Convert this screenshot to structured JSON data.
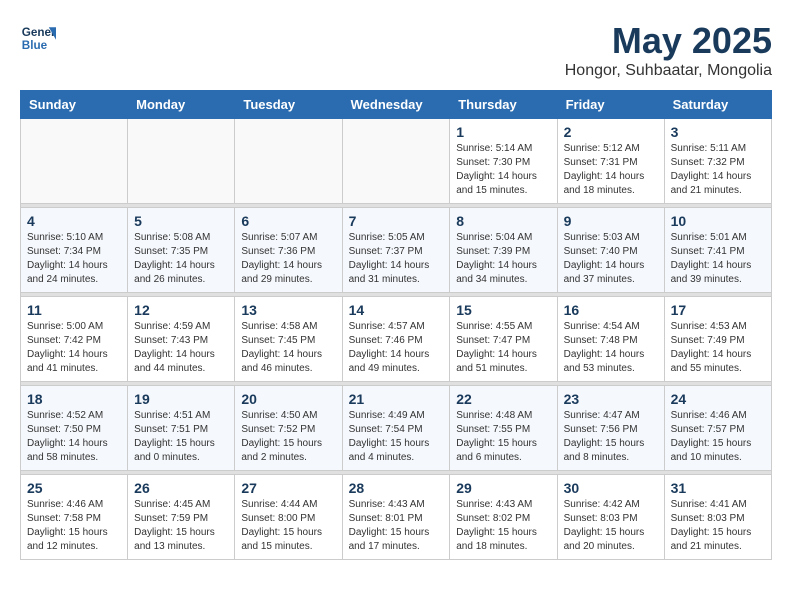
{
  "header": {
    "logo_line1": "General",
    "logo_line2": "Blue",
    "month": "May 2025",
    "location": "Hongor, Suhbaatar, Mongolia"
  },
  "days_of_week": [
    "Sunday",
    "Monday",
    "Tuesday",
    "Wednesday",
    "Thursday",
    "Friday",
    "Saturday"
  ],
  "weeks": [
    [
      {
        "day": "",
        "info": ""
      },
      {
        "day": "",
        "info": ""
      },
      {
        "day": "",
        "info": ""
      },
      {
        "day": "",
        "info": ""
      },
      {
        "day": "1",
        "info": "Sunrise: 5:14 AM\nSunset: 7:30 PM\nDaylight: 14 hours\nand 15 minutes."
      },
      {
        "day": "2",
        "info": "Sunrise: 5:12 AM\nSunset: 7:31 PM\nDaylight: 14 hours\nand 18 minutes."
      },
      {
        "day": "3",
        "info": "Sunrise: 5:11 AM\nSunset: 7:32 PM\nDaylight: 14 hours\nand 21 minutes."
      }
    ],
    [
      {
        "day": "4",
        "info": "Sunrise: 5:10 AM\nSunset: 7:34 PM\nDaylight: 14 hours\nand 24 minutes."
      },
      {
        "day": "5",
        "info": "Sunrise: 5:08 AM\nSunset: 7:35 PM\nDaylight: 14 hours\nand 26 minutes."
      },
      {
        "day": "6",
        "info": "Sunrise: 5:07 AM\nSunset: 7:36 PM\nDaylight: 14 hours\nand 29 minutes."
      },
      {
        "day": "7",
        "info": "Sunrise: 5:05 AM\nSunset: 7:37 PM\nDaylight: 14 hours\nand 31 minutes."
      },
      {
        "day": "8",
        "info": "Sunrise: 5:04 AM\nSunset: 7:39 PM\nDaylight: 14 hours\nand 34 minutes."
      },
      {
        "day": "9",
        "info": "Sunrise: 5:03 AM\nSunset: 7:40 PM\nDaylight: 14 hours\nand 37 minutes."
      },
      {
        "day": "10",
        "info": "Sunrise: 5:01 AM\nSunset: 7:41 PM\nDaylight: 14 hours\nand 39 minutes."
      }
    ],
    [
      {
        "day": "11",
        "info": "Sunrise: 5:00 AM\nSunset: 7:42 PM\nDaylight: 14 hours\nand 41 minutes."
      },
      {
        "day": "12",
        "info": "Sunrise: 4:59 AM\nSunset: 7:43 PM\nDaylight: 14 hours\nand 44 minutes."
      },
      {
        "day": "13",
        "info": "Sunrise: 4:58 AM\nSunset: 7:45 PM\nDaylight: 14 hours\nand 46 minutes."
      },
      {
        "day": "14",
        "info": "Sunrise: 4:57 AM\nSunset: 7:46 PM\nDaylight: 14 hours\nand 49 minutes."
      },
      {
        "day": "15",
        "info": "Sunrise: 4:55 AM\nSunset: 7:47 PM\nDaylight: 14 hours\nand 51 minutes."
      },
      {
        "day": "16",
        "info": "Sunrise: 4:54 AM\nSunset: 7:48 PM\nDaylight: 14 hours\nand 53 minutes."
      },
      {
        "day": "17",
        "info": "Sunrise: 4:53 AM\nSunset: 7:49 PM\nDaylight: 14 hours\nand 55 minutes."
      }
    ],
    [
      {
        "day": "18",
        "info": "Sunrise: 4:52 AM\nSunset: 7:50 PM\nDaylight: 14 hours\nand 58 minutes."
      },
      {
        "day": "19",
        "info": "Sunrise: 4:51 AM\nSunset: 7:51 PM\nDaylight: 15 hours\nand 0 minutes."
      },
      {
        "day": "20",
        "info": "Sunrise: 4:50 AM\nSunset: 7:52 PM\nDaylight: 15 hours\nand 2 minutes."
      },
      {
        "day": "21",
        "info": "Sunrise: 4:49 AM\nSunset: 7:54 PM\nDaylight: 15 hours\nand 4 minutes."
      },
      {
        "day": "22",
        "info": "Sunrise: 4:48 AM\nSunset: 7:55 PM\nDaylight: 15 hours\nand 6 minutes."
      },
      {
        "day": "23",
        "info": "Sunrise: 4:47 AM\nSunset: 7:56 PM\nDaylight: 15 hours\nand 8 minutes."
      },
      {
        "day": "24",
        "info": "Sunrise: 4:46 AM\nSunset: 7:57 PM\nDaylight: 15 hours\nand 10 minutes."
      }
    ],
    [
      {
        "day": "25",
        "info": "Sunrise: 4:46 AM\nSunset: 7:58 PM\nDaylight: 15 hours\nand 12 minutes."
      },
      {
        "day": "26",
        "info": "Sunrise: 4:45 AM\nSunset: 7:59 PM\nDaylight: 15 hours\nand 13 minutes."
      },
      {
        "day": "27",
        "info": "Sunrise: 4:44 AM\nSunset: 8:00 PM\nDaylight: 15 hours\nand 15 minutes."
      },
      {
        "day": "28",
        "info": "Sunrise: 4:43 AM\nSunset: 8:01 PM\nDaylight: 15 hours\nand 17 minutes."
      },
      {
        "day": "29",
        "info": "Sunrise: 4:43 AM\nSunset: 8:02 PM\nDaylight: 15 hours\nand 18 minutes."
      },
      {
        "day": "30",
        "info": "Sunrise: 4:42 AM\nSunset: 8:03 PM\nDaylight: 15 hours\nand 20 minutes."
      },
      {
        "day": "31",
        "info": "Sunrise: 4:41 AM\nSunset: 8:03 PM\nDaylight: 15 hours\nand 21 minutes."
      }
    ]
  ]
}
